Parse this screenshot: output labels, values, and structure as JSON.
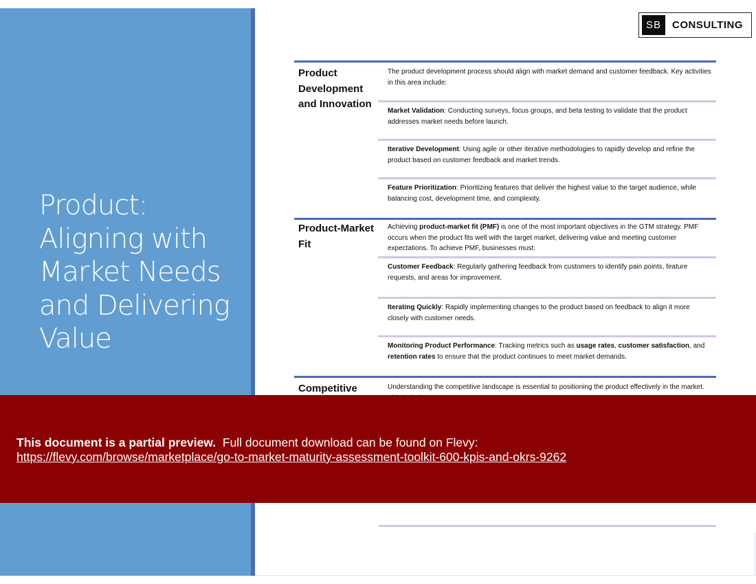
{
  "slide": {
    "title": "Product: Aligning with Market Needs and Delivering Value",
    "colors": {
      "panel": "#629dd1",
      "accent": "#4a6bbd",
      "banner": "#8b0000"
    }
  },
  "logo": {
    "mark": "SB",
    "name": "CONSULTING"
  },
  "sections": [
    {
      "heading": "Product Development and Innovation",
      "rows": [
        {
          "label": "",
          "text": "The product development process should align with market demand and customer feedback. Key activities in this area include:"
        },
        {
          "label": "Market Validation",
          "text": ": Conducting surveys, focus groups, and beta testing to validate that the product addresses market needs before launch."
        },
        {
          "label": "Iterative Development",
          "text": ": Using agile or other iterative methodologies to rapidly develop and refine the product based on customer feedback and market trends."
        },
        {
          "label": "Feature Prioritization",
          "text": ": Prioritizing features that deliver the highest value to the target audience, while balancing cost, development time, and complexity."
        }
      ]
    },
    {
      "heading": "Product-Market Fit",
      "rows": [
        {
          "pre": "Achieving ",
          "label": "product-market fit (PMF)",
          "text": " is one of the most important objectives in the GTM strategy. PMF occurs when the product fits well with the target market, delivering value and meeting customer expectations. To achieve PMF, businesses must:"
        },
        {
          "label": "Customer Feedback",
          "text": ": Regularly gathering feedback from customers to identify pain points, feature requests, and areas for improvement."
        },
        {
          "label": "Iterating Quickly",
          "text": ": Rapidly implementing changes to the product based on feedback to align it more closely with customer needs."
        },
        {
          "label": "Monitoring Product Performance",
          "text": ": Tracking metrics such as ",
          "b1": "usage rates",
          "t1": ", ",
          "b2": "customer satisfaction",
          "t2": ", and ",
          "b3": "retention rates",
          "t3": " to ensure that the product continues to meet market demands."
        }
      ]
    },
    {
      "heading": "Competitive",
      "rows": [
        {
          "label": "",
          "text": "Understanding the competitive landscape is essential to positioning the product effectively in the market. This includes:"
        }
      ]
    }
  ],
  "banner": {
    "bold": "This document is a partial preview.",
    "text": "Full document download can be found on Flevy:",
    "link": "https://flevy.com/browse/marketplace/go-to-market-maturity-assessment-toolkit-600-kpis-and-okrs-9262"
  }
}
